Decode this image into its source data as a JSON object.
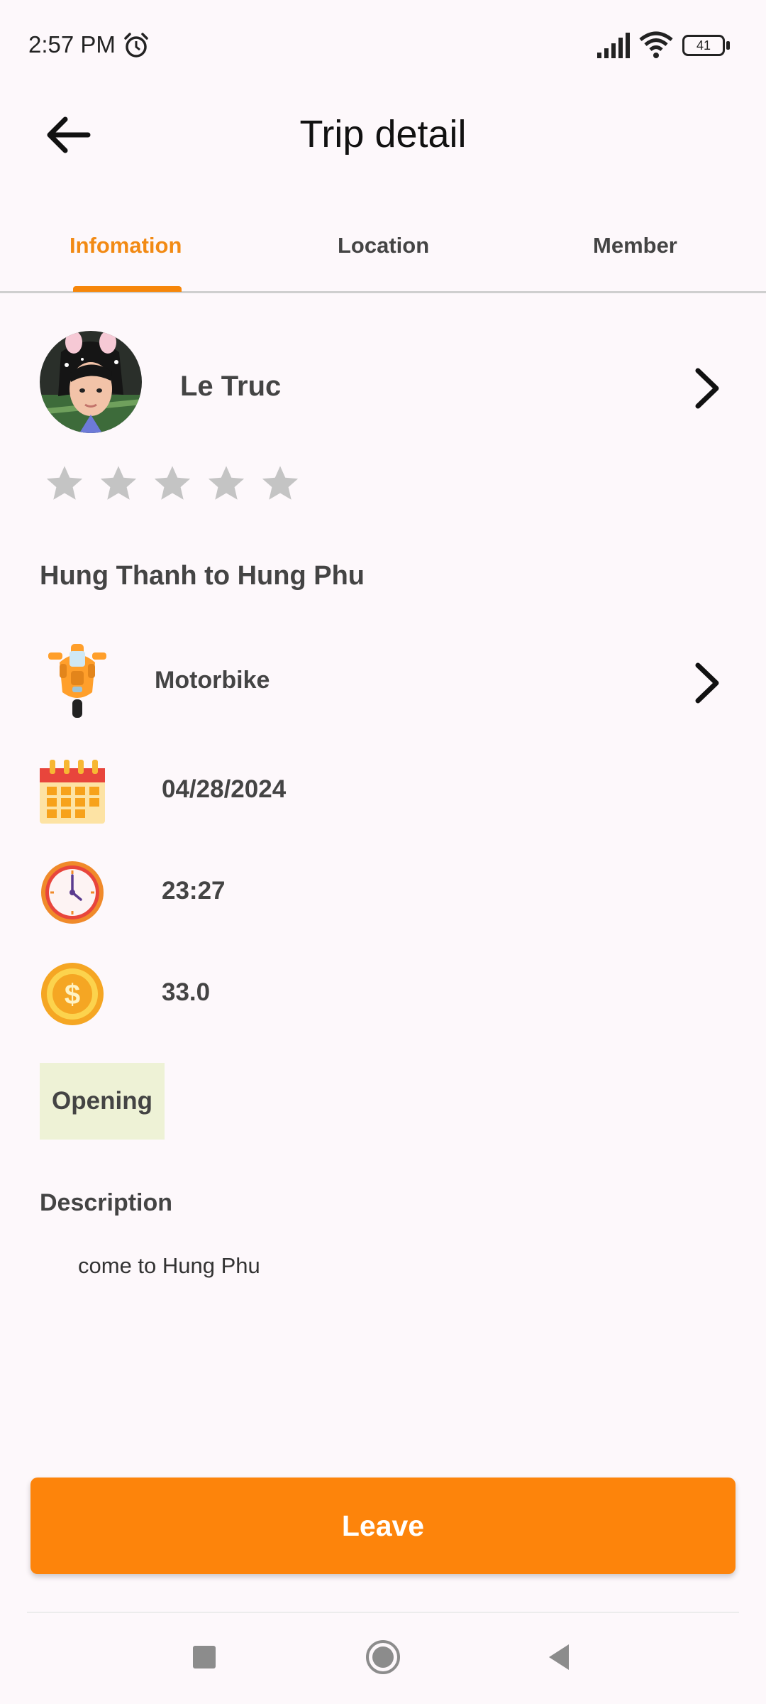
{
  "status_bar": {
    "time": "2:57 PM",
    "battery": "41",
    "icons": [
      "alarm-icon",
      "signal-icon",
      "wifi-icon",
      "battery-icon"
    ]
  },
  "header": {
    "title": "Trip detail",
    "back_icon": "arrow-left-icon"
  },
  "tabs": [
    {
      "label": "Infomation",
      "active": true
    },
    {
      "label": "Location",
      "active": false
    },
    {
      "label": "Member",
      "active": false
    }
  ],
  "driver": {
    "name": "Le Truc",
    "rating": 0,
    "rating_max": 5
  },
  "trip": {
    "route": "Hung Thanh to Hung Phu",
    "vehicle": "Motorbike",
    "date": "04/28/2024",
    "time": "23:27",
    "price": "33.0",
    "status": "Opening"
  },
  "description": {
    "heading": "Description",
    "text": "come to Hung Phu"
  },
  "actions": {
    "leave_label": "Leave"
  },
  "colors": {
    "accent": "#fd840b",
    "tab_active": "#f28a14",
    "status_badge_bg": "#eef2d6",
    "background": "#fdf8fb"
  }
}
